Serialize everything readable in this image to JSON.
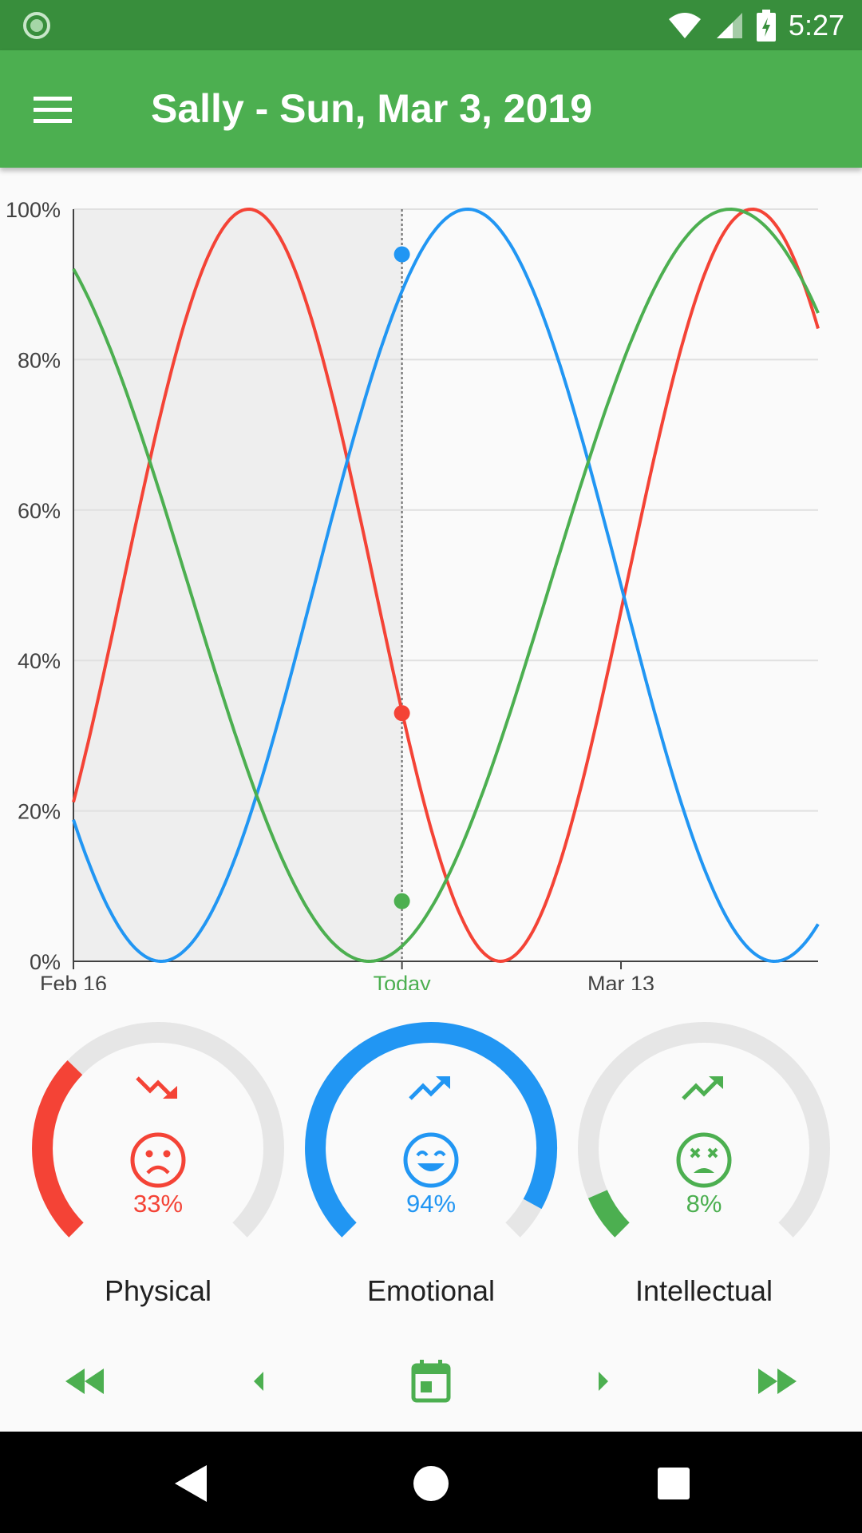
{
  "status_bar": {
    "time": "5:27"
  },
  "app_bar": {
    "title": "Sally - Sun, Mar 3, 2019"
  },
  "colors": {
    "physical": "#f44336",
    "emotional": "#2196f3",
    "intellectual": "#4caf50",
    "primary": "#4caf50",
    "primary_dark": "#388e3c",
    "track": "#e6e6e6"
  },
  "chart_data": {
    "type": "line",
    "x_start": "Feb 16",
    "x_today": "Mar 3",
    "x_end": "Mar 22",
    "x_ticks": [
      "Feb 16",
      "Today",
      "Mar 13"
    ],
    "y_ticks": [
      "0%",
      "20%",
      "40%",
      "60%",
      "80%",
      "100%"
    ],
    "ylim": [
      0,
      100
    ],
    "past_shaded": true,
    "grid": true,
    "series": [
      {
        "key": "physical",
        "period_days": 23,
        "peak": "Feb 24",
        "today_value": 33
      },
      {
        "key": "emotional",
        "period_days": 28,
        "peak": "Mar 6",
        "today_value": 94
      },
      {
        "key": "intellectual",
        "period_days": 33,
        "peak": "Mar 18",
        "today_value": 8
      }
    ]
  },
  "gauges": [
    {
      "key": "physical",
      "label": "Physical",
      "value_text": "33%",
      "value": 33,
      "trend": "trending-down-icon",
      "face": "sad-face-icon"
    },
    {
      "key": "emotional",
      "label": "Emotional",
      "value_text": "94%",
      "value": 94,
      "trend": "trending-up-icon",
      "face": "happy-face-icon"
    },
    {
      "key": "intellectual",
      "label": "Intellectual",
      "value_text": "8%",
      "value": 8,
      "trend": "trending-up-icon",
      "face": "dizzy-face-icon"
    }
  ],
  "nav": [
    "fast-rewind-icon",
    "previous-icon",
    "calendar-today-icon",
    "next-icon",
    "fast-forward-icon"
  ]
}
